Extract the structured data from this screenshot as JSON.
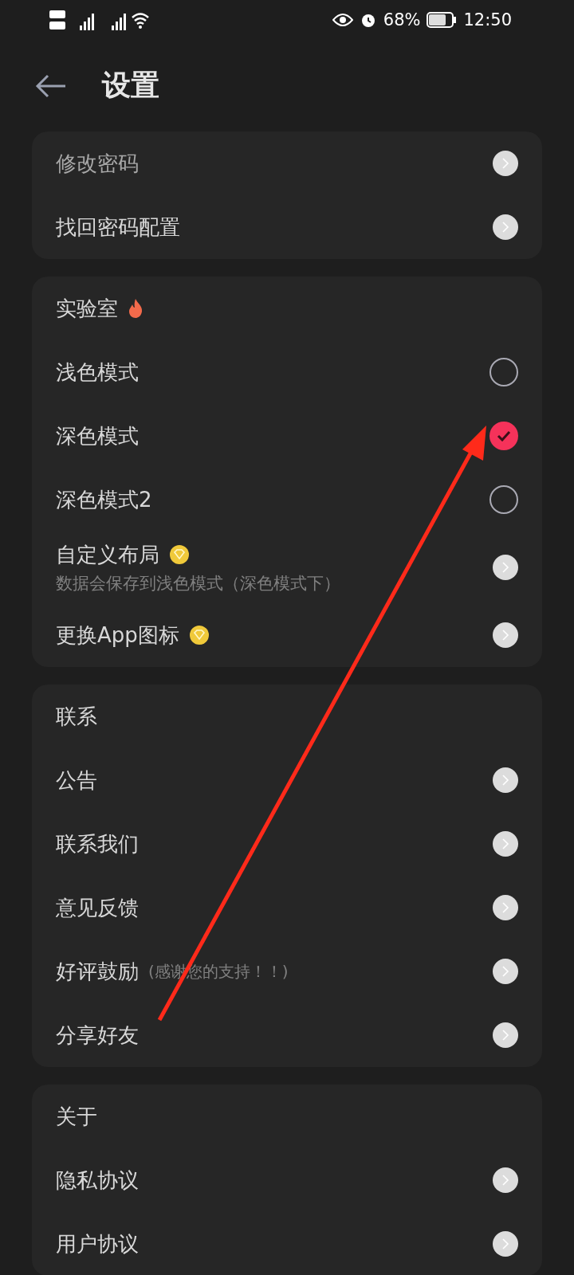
{
  "status_bar": {
    "battery": "68%",
    "time": "12:50"
  },
  "header": {
    "title": "设置"
  },
  "sections": [
    {
      "items": [
        {
          "kind": "link",
          "label": "修改密码"
        },
        {
          "kind": "link",
          "label": "找回密码配置"
        }
      ]
    },
    {
      "title": "实验室",
      "hot": true,
      "items": [
        {
          "kind": "radio",
          "label": "浅色模式",
          "selected": false
        },
        {
          "kind": "radio",
          "label": "深色模式",
          "selected": true
        },
        {
          "kind": "radio",
          "label": "深色模式2",
          "selected": false
        },
        {
          "kind": "link",
          "label": "自定义布局",
          "premium": true,
          "subtitle": "数据会保存到浅色模式（深色模式下）"
        },
        {
          "kind": "link",
          "label": "更换App图标",
          "premium": true
        }
      ]
    },
    {
      "title": "联系",
      "items": [
        {
          "kind": "link",
          "label": "公告"
        },
        {
          "kind": "link",
          "label": "联系我们"
        },
        {
          "kind": "link",
          "label": "意见反馈"
        },
        {
          "kind": "link",
          "label": "好评鼓励",
          "note": "(感谢您的支持！！)"
        },
        {
          "kind": "link",
          "label": "分享好友"
        }
      ]
    },
    {
      "title": "关于",
      "items": [
        {
          "kind": "link",
          "label": "隐私协议"
        },
        {
          "kind": "link",
          "label": "用户协议"
        }
      ]
    }
  ]
}
